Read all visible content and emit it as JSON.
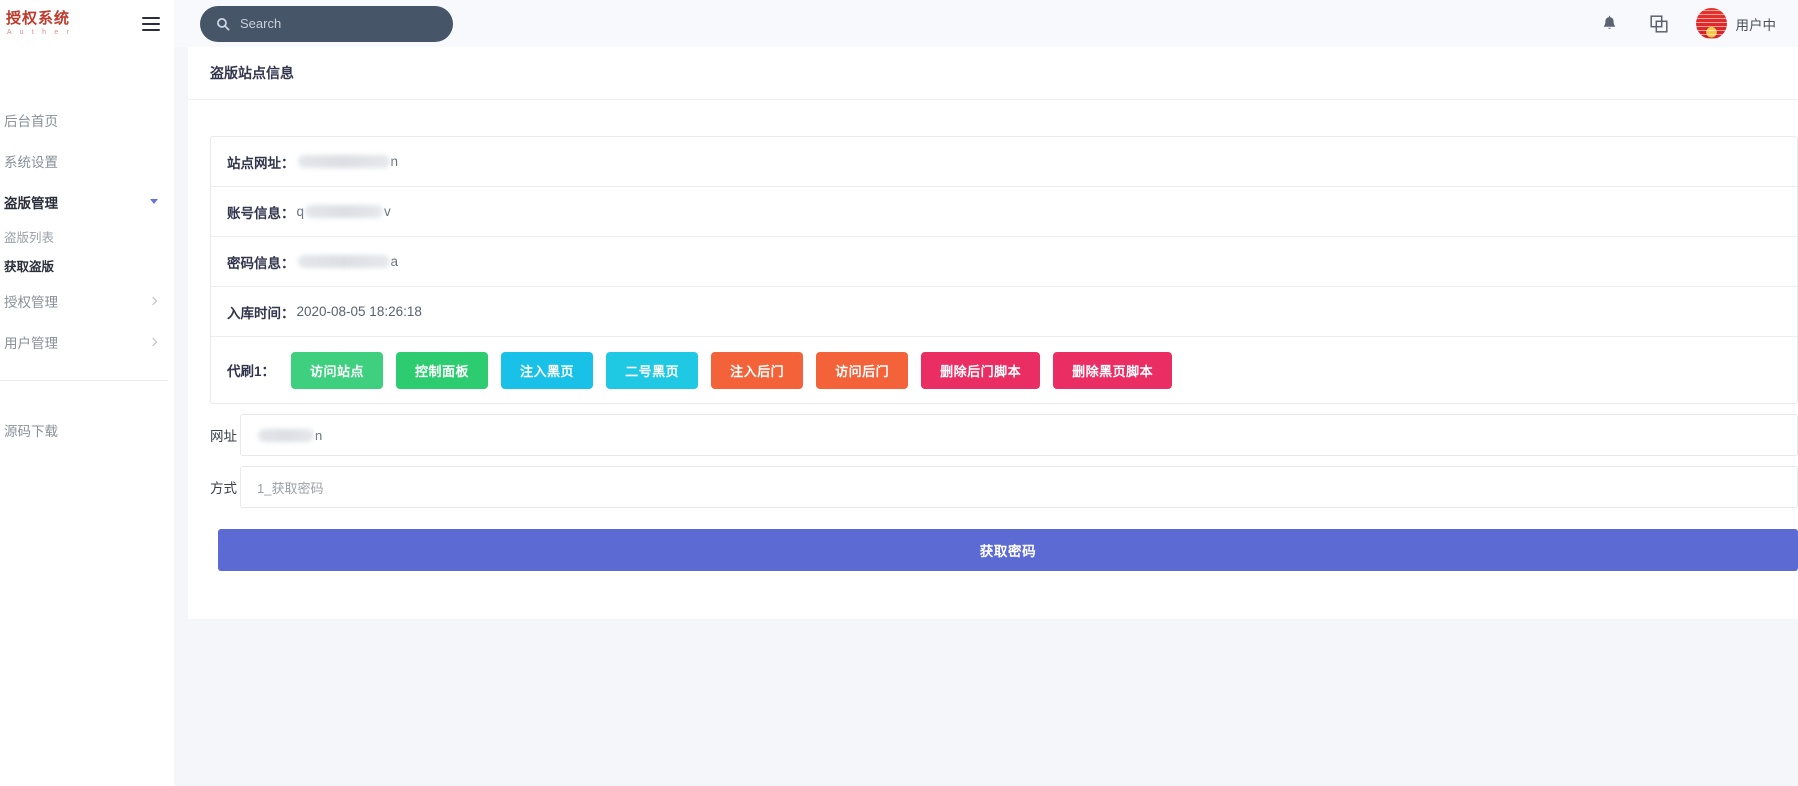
{
  "brand": {
    "name_cn": "授权系统",
    "name_en": "A u t h e r"
  },
  "sidebar": {
    "items": [
      {
        "label": "后台首页",
        "type": "top"
      },
      {
        "label": "系统设置",
        "type": "top"
      },
      {
        "label": "盗版管理",
        "type": "parent",
        "expanded": true
      },
      {
        "label": "盗版列表",
        "type": "sub"
      },
      {
        "label": "获取盗版",
        "type": "sub",
        "current": true
      },
      {
        "label": "授权管理",
        "type": "parent"
      },
      {
        "label": "用户管理",
        "type": "parent"
      }
    ],
    "tail_item": {
      "label": "源码下载"
    }
  },
  "topbar": {
    "search_placeholder": "Search",
    "search_value": "",
    "icons": [
      "bell-icon",
      "window-copy-icon"
    ],
    "user_name": "用户中"
  },
  "page": {
    "title": "盗版站点信息"
  },
  "site_info": {
    "rows": [
      {
        "label": "站点网址：",
        "masked": true,
        "mask_width": "bw3",
        "tail": "n"
      },
      {
        "label": "账号信息：",
        "masked": true,
        "mask_width": "bw2",
        "lead": "q",
        "tail": "v"
      },
      {
        "label": "密码信息：",
        "masked": true,
        "mask_width": "bw3",
        "tail": "a"
      },
      {
        "label": "入库时间：",
        "masked": false,
        "value": "2020-08-05 18:26:18"
      }
    ]
  },
  "actions": {
    "label": "代刷1：",
    "buttons": [
      {
        "text": "访问站点",
        "color": "#3fd07f"
      },
      {
        "text": "控制面板",
        "color": "#2ecc71"
      },
      {
        "text": "注入黑页",
        "color": "#19c1e8"
      },
      {
        "text": "二号黑页",
        "color": "#1fc8e3"
      },
      {
        "text": "注入后门",
        "color": "#f4623a"
      },
      {
        "text": "访问后门",
        "color": "#f4623a"
      },
      {
        "text": "删除后门脚本",
        "color": "#ea2e63"
      },
      {
        "text": "删除黑页脚本",
        "color": "#ea2e63"
      }
    ]
  },
  "form": {
    "url_field": {
      "label": "网址",
      "value_masked": true,
      "value_tail": "n",
      "placeholder": ""
    },
    "method_field": {
      "label": "方式",
      "value": "1_获取密码"
    },
    "submit_label": "获取密码"
  },
  "colors": {
    "accent_submit": "#5c6bd4",
    "search_bg": "#475569",
    "brand_red": "#c0392b",
    "page_bg": "#f4f6f9"
  }
}
